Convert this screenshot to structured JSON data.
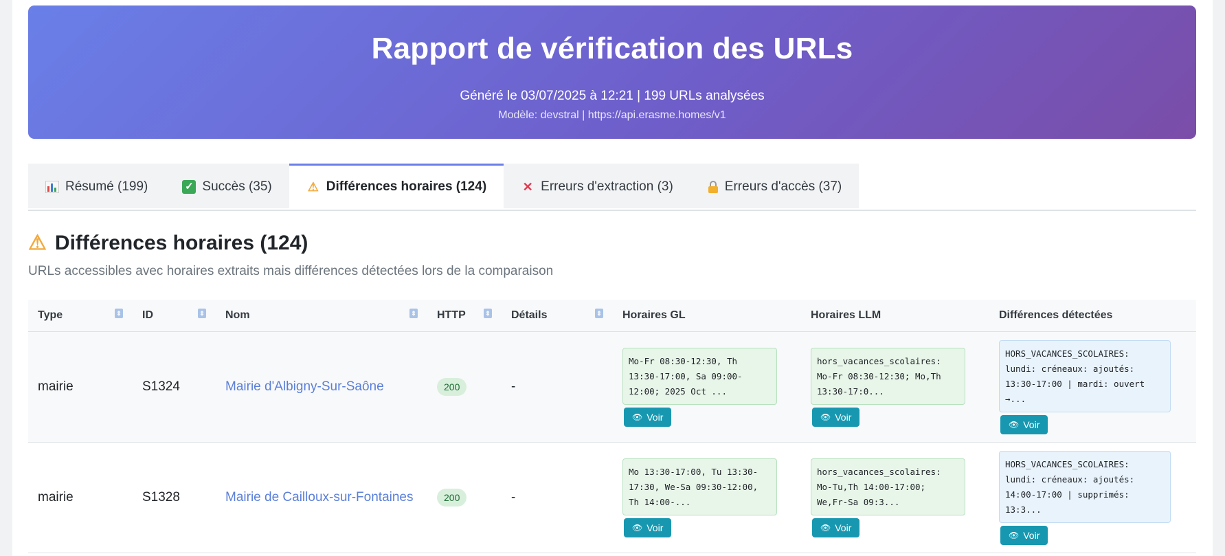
{
  "header": {
    "title": "Rapport de vérification des URLs",
    "subtitle": "Généré le 03/07/2025 à 12:21 | 199 URLs analysées",
    "meta": "Modèle: devstral | https://api.erasme.homes/v1"
  },
  "tabs": [
    {
      "label": "Résumé (199)",
      "icon": "bar-chart-icon"
    },
    {
      "label": "Succès (35)",
      "icon": "check-icon"
    },
    {
      "label": "Différences horaires (124)",
      "icon": "warning-icon",
      "active": true
    },
    {
      "label": "Erreurs d'extraction (3)",
      "icon": "cross-icon"
    },
    {
      "label": "Erreurs d'accès (37)",
      "icon": "lock-icon"
    }
  ],
  "section": {
    "title": "Différences horaires (124)",
    "description": "URLs accessibles avec horaires extraits mais différences détectées lors de la comparaison"
  },
  "table": {
    "columns": [
      "Type",
      "ID",
      "Nom",
      "HTTP",
      "Détails",
      "Horaires GL",
      "Horaires LLM",
      "Différences détectées"
    ],
    "voir_label": "Voir",
    "rows": [
      {
        "type": "mairie",
        "id": "S1324",
        "nom": "Mairie d'Albigny-Sur-Saône",
        "http": "200",
        "details": "-",
        "horaires_gl": "Mo-Fr 08:30-12:30, Th 13:30-17:00, Sa 09:00-12:00; 2025 Oct ...",
        "horaires_llm": "hors_vacances_scolaires: Mo-Fr 08:30-12:30; Mo,Th 13:30-17:0...",
        "differences": "HORS_VACANCES_SCOLAIRES: lundi: créneaux: ajoutés: 13:30-17:00 | mardi: ouvert →..."
      },
      {
        "type": "mairie",
        "id": "S1328",
        "nom": "Mairie de Cailloux-sur-Fontaines",
        "http": "200",
        "details": "-",
        "horaires_gl": "Mo 13:30-17:00, Tu 13:30-17:30, We-Sa 09:30-12:00, Th 14:00-...",
        "horaires_llm": "hors_vacances_scolaires: Mo-Tu,Th 14:00-17:00; We,Fr-Sa 09:3...",
        "differences": "HORS_VACANCES_SCOLAIRES: lundi: créneaux: ajoutés: 14:00-17:00 | supprimés: 13:3..."
      }
    ]
  }
}
